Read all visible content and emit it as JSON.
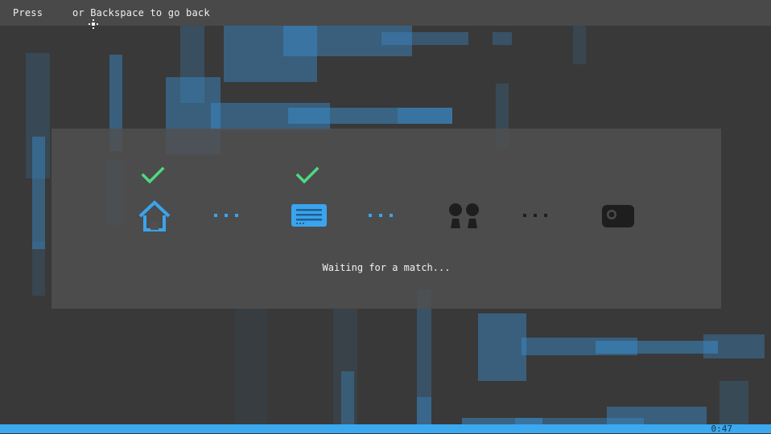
{
  "top_hint": {
    "before": "Press ",
    "icon": "dpad-button-icon",
    "after": " or Backspace to go back"
  },
  "stages": [
    {
      "name": "home",
      "icon": "home-icon",
      "done": true,
      "active": true
    },
    {
      "name": "server",
      "icon": "server-list-icon",
      "done": true,
      "active": true
    },
    {
      "name": "players",
      "icon": "players-icon",
      "done": false,
      "active": false
    },
    {
      "name": "game",
      "icon": "gamepad-icon",
      "done": false,
      "active": false
    }
  ],
  "status_text": "Waiting for a match...",
  "timer": "0:47",
  "colors": {
    "accent": "#3aa9f0",
    "check": "#4fd97f",
    "inactive": "#1e1e1e",
    "panel": "#505050",
    "background": "#393939"
  }
}
